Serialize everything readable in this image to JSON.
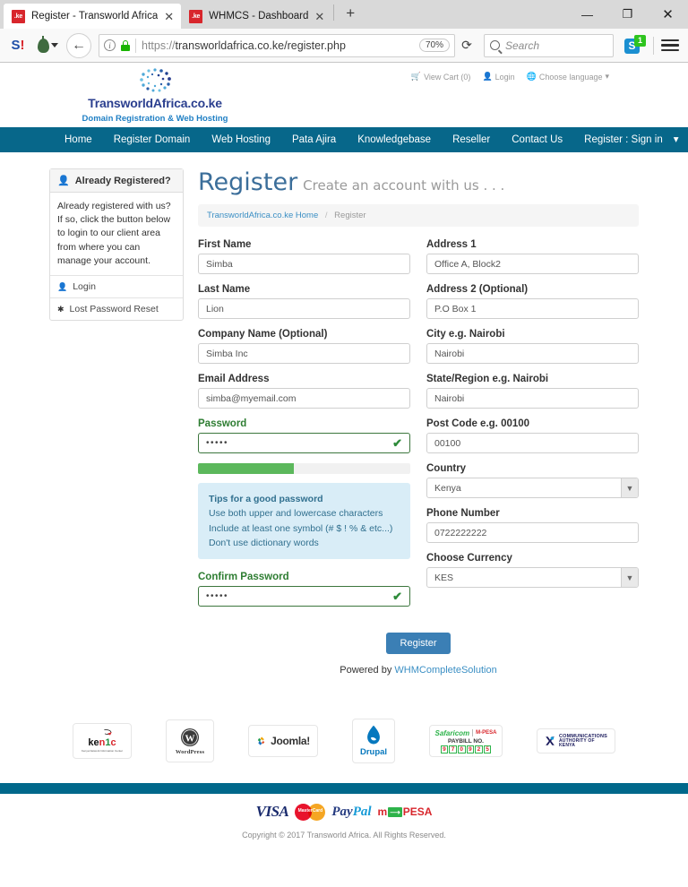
{
  "browser": {
    "tabs": [
      {
        "favicon": ".ke",
        "title": "Register - Transworld Africa",
        "close": "✕",
        "active": true
      },
      {
        "favicon": ".ke",
        "title": "WHMCS - Dashboard",
        "close": "✕",
        "active": false
      }
    ],
    "new_tab": "+",
    "window_controls": {
      "minimize": "—",
      "maximize": "❐",
      "close": "✕"
    },
    "toolbar": {
      "stumbleupon_label": "S",
      "stumbleupon_excl": "!",
      "back": "←",
      "info": "i",
      "url_scheme": "https://",
      "url_rest": "transworldafrica.co.ke/register.php",
      "zoom_level": "70%",
      "reload": "⟳",
      "search_placeholder": "Search",
      "skype_label": "S",
      "skype_badge": "1"
    }
  },
  "site": {
    "logo": {
      "name": "TransworldAfrica.co.ke",
      "tagline": "Domain Registration & Web Hosting"
    },
    "utility_links": [
      {
        "icon": "cart-icon",
        "label": "View Cart (0)"
      },
      {
        "icon": "user-icon",
        "label": "Login"
      },
      {
        "icon": "globe-icon",
        "label": "Choose language",
        "caret": "▾"
      }
    ],
    "nav": [
      "Home",
      "Register Domain",
      "Web Hosting",
      "Pata Ajira",
      "Knowledgebase",
      "Reseller",
      "Contact Us"
    ],
    "nav_account": "Register : Sign in",
    "nav_account_caret": "▾"
  },
  "sidebar": {
    "panel_title": "Already Registered?",
    "panel_icon": "user-icon",
    "panel_body": "Already registered with us? If so, click the button below to login to our client area from where you can manage your account.",
    "links": [
      {
        "icon": "user-icon",
        "label": "Login"
      },
      {
        "icon": "asterisk-icon",
        "label": "Lost Password Reset"
      }
    ]
  },
  "main": {
    "title": "Register",
    "subtitle": "Create an account with us . . .",
    "breadcrumb": {
      "home": "TransworldAfrica.co.ke Home",
      "divider": "/",
      "current": "Register"
    },
    "left_fields": [
      {
        "label": "First Name",
        "value": "Simba",
        "type": "text"
      },
      {
        "label": "Last Name",
        "value": "Lion",
        "type": "text"
      },
      {
        "label": "Company Name (Optional)",
        "value": "Simba Inc",
        "type": "text"
      },
      {
        "label": "Email Address",
        "value": "simba@myemail.com",
        "type": "text"
      }
    ],
    "password": {
      "label": "Password",
      "value": "•••••",
      "check": "✔",
      "strength_percent": 45
    },
    "tips": {
      "heading": "Tips for a good password",
      "lines": [
        "Use both upper and lowercase characters",
        "Include at least one symbol (# $ ! % & etc...)",
        "Don't use dictionary words"
      ]
    },
    "confirm_password": {
      "label": "Confirm Password",
      "value": "•••••",
      "check": "✔"
    },
    "right_fields": [
      {
        "label": "Address 1",
        "value": "Office A, Block2",
        "type": "text"
      },
      {
        "label": "Address 2 (Optional)",
        "value": "P.O Box 1",
        "type": "text"
      },
      {
        "label": "City e.g. Nairobi",
        "value": "Nairobi",
        "type": "text"
      },
      {
        "label": "State/Region e.g. Nairobi",
        "value": "Nairobi",
        "type": "text"
      },
      {
        "label": "Post Code e.g. 00100",
        "value": "00100",
        "type": "text"
      },
      {
        "label": "Country",
        "value": "Kenya",
        "type": "select"
      },
      {
        "label": "Phone Number",
        "value": "0722222222",
        "type": "text"
      },
      {
        "label": "Choose Currency",
        "value": "KES",
        "type": "select"
      }
    ],
    "submit_label": "Register",
    "powered_prefix": "Powered by ",
    "powered_link": "WHMCompleteSolution"
  },
  "partners": [
    {
      "name": "kenic-logo",
      "text": "kenic",
      "sub": "Kenya Network Information Center"
    },
    {
      "name": "wordpress-logo",
      "text": "WordPress"
    },
    {
      "name": "joomla-logo",
      "text": "Joomla!"
    },
    {
      "name": "drupal-logo",
      "text": "Drupal"
    },
    {
      "name": "safaricom-mpesa-logo",
      "text": "Safaricom",
      "sub": "PAYBILL NO.",
      "digits": "970925"
    },
    {
      "name": "communications-authority-logo",
      "text": "COMMUNICATIONS",
      "sub": "AUTHORITY OF KENYA"
    }
  ],
  "footer": {
    "payments": [
      "VISA",
      "MasterCard",
      "PayPal",
      "M-PESA"
    ],
    "copyright": "Copyright © 2017 Transworld Africa. All Rights Reserved."
  },
  "colors": {
    "nav_teal": "#07678a",
    "footer_teal": "#00688b",
    "title_blue": "#3b6e9a",
    "accent_blue": "#3b8fc4",
    "success_green": "#5cb85c",
    "tips_bg": "#d9edf7",
    "tips_text": "#31708f"
  }
}
